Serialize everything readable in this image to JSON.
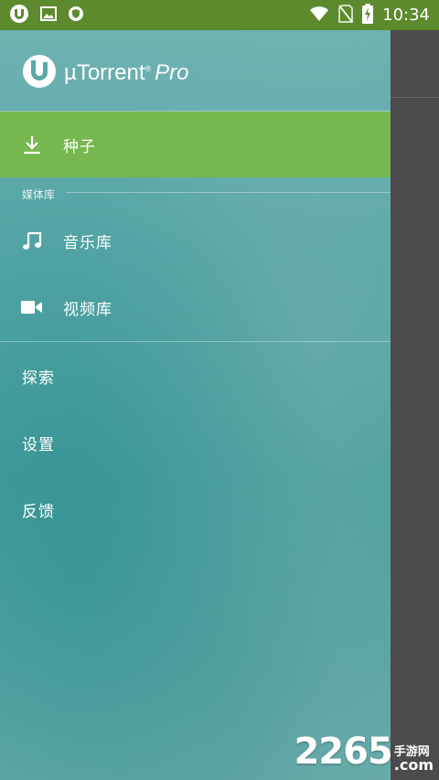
{
  "statusbar": {
    "time": "10:34",
    "icons_left": [
      "utorrent-icon",
      "image-icon",
      "shield-icon"
    ],
    "icons_right": [
      "wifi-icon",
      "no-sim-icon",
      "battery-charging-icon"
    ]
  },
  "app": {
    "name": "µTorrent",
    "registered": "®",
    "edition": "Pro"
  },
  "menu": {
    "torrents": "种子",
    "media_section": "媒体库",
    "music": "音乐库",
    "video": "视频库",
    "search": "探索",
    "settings": "设置",
    "feedback": "反馈"
  },
  "watermark": {
    "number": "2265",
    "line1": "手游网",
    "line2": ".com"
  },
  "colors": {
    "statusbar": "#5c8a2c",
    "active_item": "#76b74f",
    "drawer": "#5aa8a8",
    "overlay": "#4b4b4b"
  }
}
